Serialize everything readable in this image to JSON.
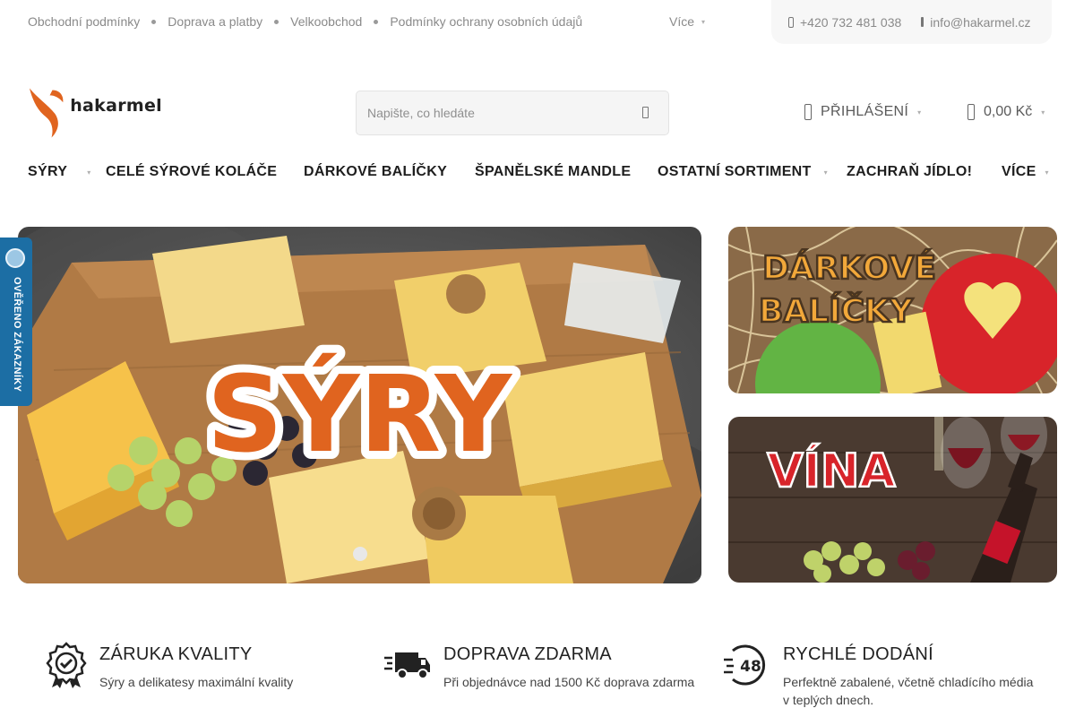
{
  "topbar": {
    "links": [
      "Obchodní podmínky",
      "Doprava a platby",
      "Velkoobchod",
      "Podmínky ochrany osobních údajů"
    ],
    "more_label": "Více",
    "phone": "+420 732 481 038",
    "email": "info@hakarmel.cz"
  },
  "header": {
    "logo_text": "hakarmel",
    "search_placeholder": "Napište, co hledáte",
    "login_label": "PŘIHLÁŠENÍ",
    "cart_total": "0,00 Kč"
  },
  "nav": {
    "items": [
      "SÝRY",
      "CELÉ SÝROVÉ KOLÁČE",
      "DÁRKOVÉ BALÍČKY",
      "ŠPANĚLSKÉ MANDLE",
      "OSTATNÍ SORTIMENT",
      "ZACHRAŇ JÍDLO!",
      "VÍCE"
    ]
  },
  "banners": {
    "hero_text": "SÝRY",
    "gift_line1": "DÁRKOVÉ",
    "gift_line2": "BALÍČKY",
    "wine_text": "VÍNA"
  },
  "badge": {
    "text": "OVĚŘENO ZÁKAZNÍKY"
  },
  "features": [
    {
      "title": "ZÁRUKA KVALITY",
      "desc": "Sýry a delikatesy maximální kvality",
      "icon": "quality-badge-icon"
    },
    {
      "title": "DOPRAVA ZDARMA",
      "desc": "Při objednávce nad 1500 Kč doprava zdarma",
      "icon": "delivery-truck-icon"
    },
    {
      "title": "RYCHLÉ DODÁNÍ",
      "desc": "Perfektně zabalené, včetně chladícího média v teplých dnech.",
      "icon": "48h-delivery-icon"
    }
  ],
  "colors": {
    "accent_orange": "#e0641f",
    "badge_blue": "#1c6ea4",
    "wine_red": "#d8242a"
  }
}
